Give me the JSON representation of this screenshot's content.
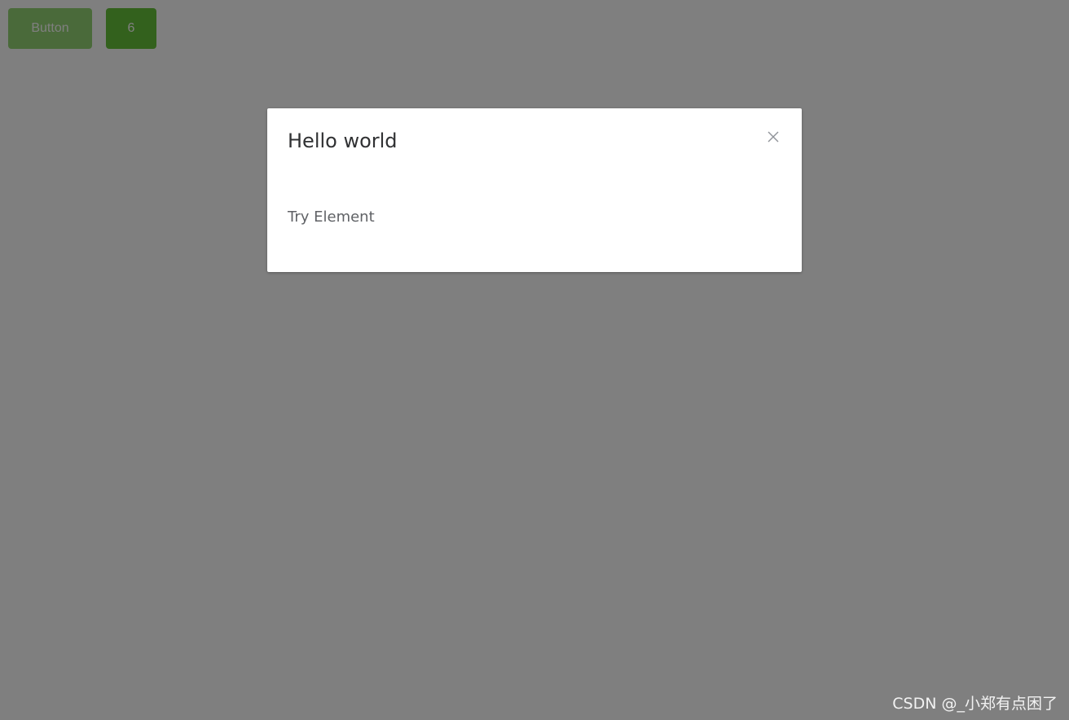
{
  "page": {
    "primary_button_label": "Button",
    "counter_button_label": "6"
  },
  "dialog": {
    "title": "Hello world",
    "body": "Try Element",
    "close_icon": "close-icon"
  },
  "watermark": "CSDN @_小郑有点困了",
  "colors": {
    "overlay": "#808080",
    "primary_button": "#95d475",
    "counter_button": "#67c23a"
  }
}
